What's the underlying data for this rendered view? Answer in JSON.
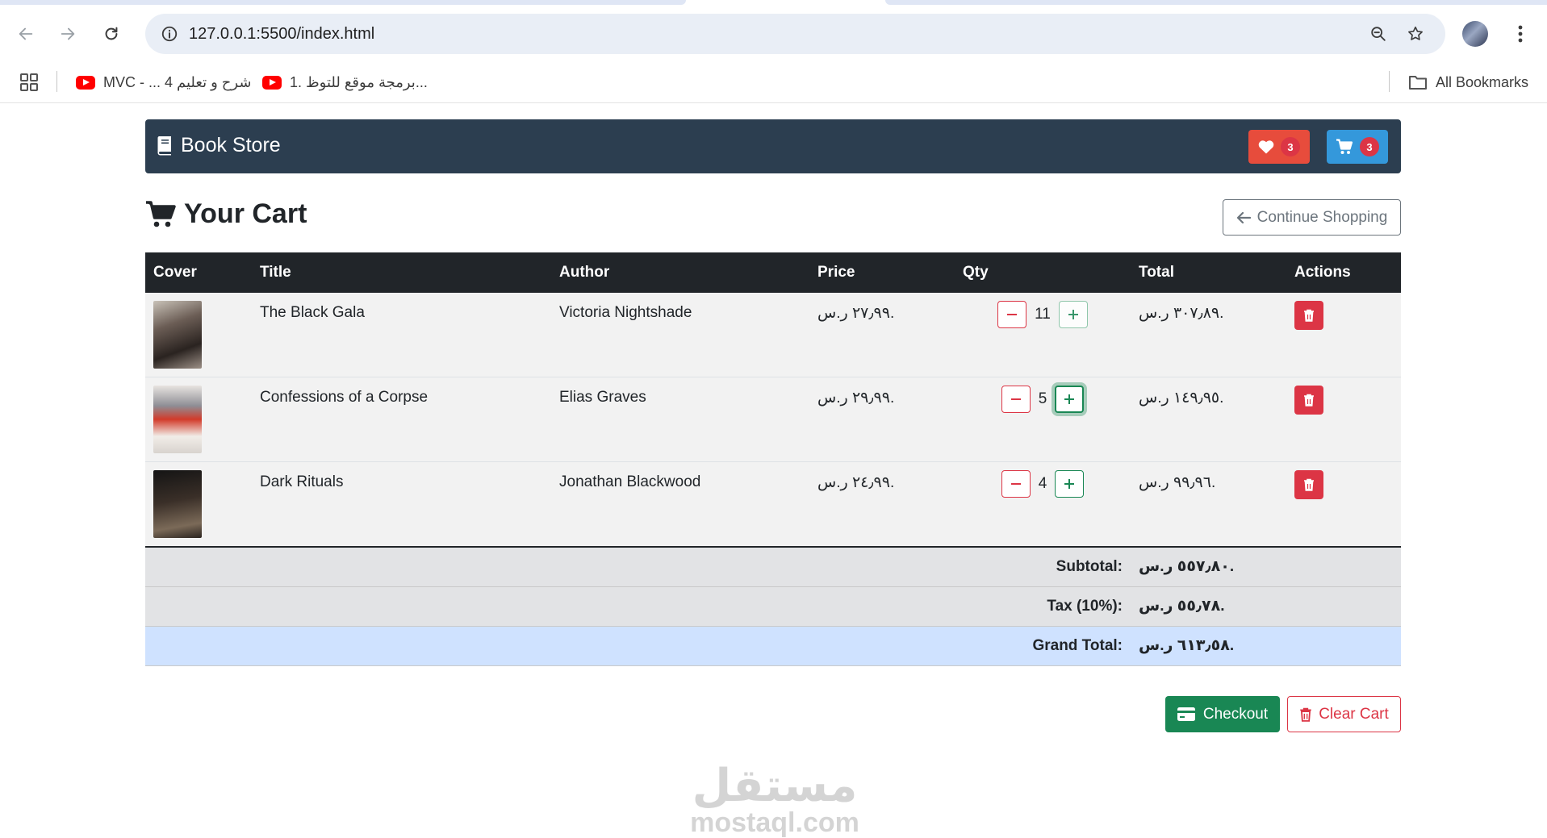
{
  "browser": {
    "url": "127.0.0.1:5500/index.html",
    "bookmarks": [
      {
        "label": "MVC - ... 4 شرح و تعليم",
        "icon": "youtube-icon"
      },
      {
        "label": "1. برمجة موقع للتوظ...",
        "icon": "youtube-icon"
      }
    ],
    "all_bookmarks_label": "All Bookmarks"
  },
  "navbar": {
    "brand": "Book Store",
    "favorites_count": "3",
    "cart_count": "3",
    "colors": {
      "bar": "#2c3e50",
      "favorites": "#e74c3c",
      "cart": "#3498db"
    }
  },
  "cart": {
    "heading": "Your Cart",
    "continue_label": "Continue Shopping",
    "columns": [
      "Cover",
      "Title",
      "Author",
      "Price",
      "Qty",
      "Total",
      "Actions"
    ],
    "items": [
      {
        "title": "The Black Gala",
        "author": "Victoria Nightshade",
        "price": "٢٧٫٩٩ ر.س.",
        "qty": "11",
        "total": "٣٠٧٫٨٩ ر.س."
      },
      {
        "title": "Confessions of a Corpse",
        "author": "Elias Graves",
        "price": "٢٩٫٩٩ ر.س.",
        "qty": "5",
        "total": "١٤٩٫٩٥ ر.س."
      },
      {
        "title": "Dark Rituals",
        "author": "Jonathan Blackwood",
        "price": "٢٤٫٩٩ ر.س.",
        "qty": "4",
        "total": "٩٩٫٩٦ ر.س."
      }
    ],
    "summary": {
      "subtotal_label": "Subtotal:",
      "subtotal": "٥٥٧٫٨٠ ر.س.",
      "tax_label": "Tax (10%):",
      "tax": "٥٥٫٧٨ ر.س.",
      "grand_label": "Grand Total:",
      "grand": "٦١٣٫٥٨ ر.س."
    },
    "checkout_label": "Checkout",
    "clear_label": "Clear Cart"
  },
  "watermark": {
    "arabic": "مستقل",
    "latin": "mostaql.com"
  }
}
